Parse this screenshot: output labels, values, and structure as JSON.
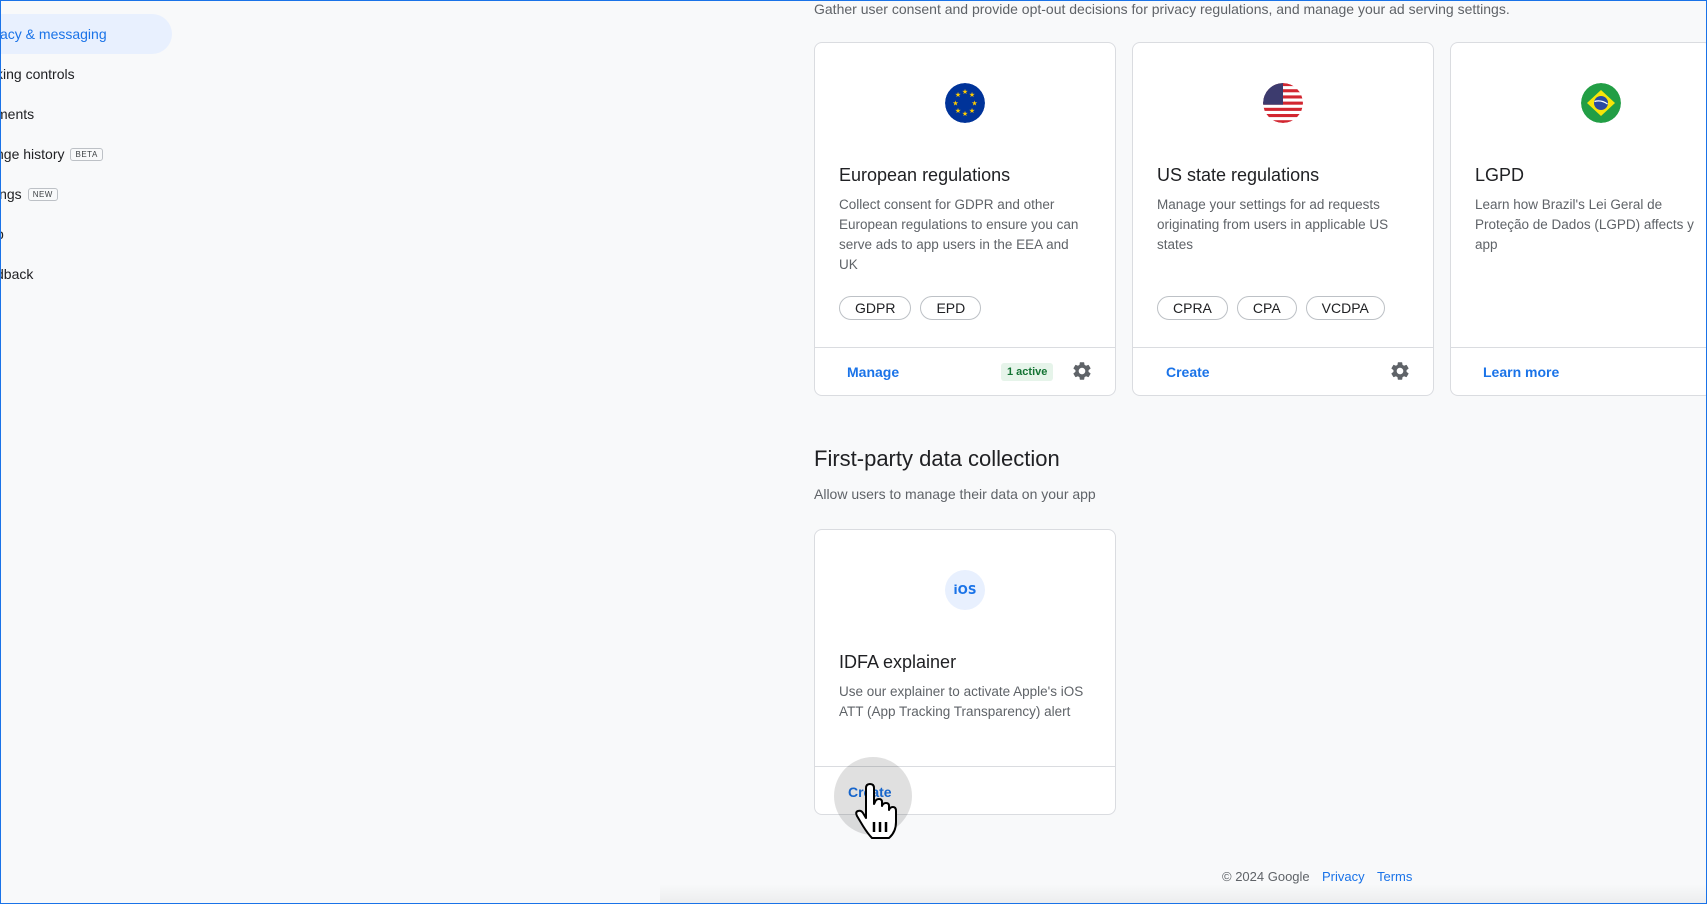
{
  "sidebar": {
    "items": [
      {
        "label": "acy & messaging",
        "badge": null,
        "active": true
      },
      {
        "label": "king controls",
        "badge": null
      },
      {
        "label": "ments",
        "badge": null
      },
      {
        "label": "nge history",
        "badge": "BETA"
      },
      {
        "label": "ings",
        "badge": "NEW"
      },
      {
        "label": "p",
        "badge": null
      },
      {
        "label": "dback",
        "badge": null
      }
    ]
  },
  "regulations": {
    "description": "Gather user consent and provide opt-out decisions for privacy regulations, and manage your ad serving settings.",
    "cards": [
      {
        "title": "European regulations",
        "description": "Collect consent for GDPR and other European regulations to ensure you can serve ads to app users in the EEA and UK",
        "chips": [
          "GDPR",
          "EPD"
        ],
        "action": "Manage",
        "status_badge": "1 active",
        "icon": "eu-flag-icon"
      },
      {
        "title": "US state regulations",
        "description": "Manage your settings for ad requests originating from users in applicable US states",
        "chips": [
          "CPRA",
          "CPA",
          "VCDPA"
        ],
        "action": "Create",
        "icon": "us-flag-icon"
      },
      {
        "title": "LGPD",
        "description": "Learn how Brazil's Lei Geral de Proteção de Dados (LGPD) affects y app",
        "action": "Learn more",
        "icon": "brazil-flag-icon"
      }
    ]
  },
  "first_party": {
    "title": "First-party data collection",
    "description": "Allow users to manage their data on your app",
    "card": {
      "icon_text": "iOS",
      "title": "IDFA explainer",
      "description": "Use our explainer to activate Apple's iOS ATT (App Tracking Transparency) alert",
      "action": "Create"
    }
  },
  "footer": {
    "copyright": "© 2024 Google",
    "privacy": "Privacy",
    "terms": "Terms"
  },
  "colors": {
    "accent": "#1a73e8",
    "active_badge_bg": "#e6f4ea",
    "active_badge_text": "#137333"
  }
}
